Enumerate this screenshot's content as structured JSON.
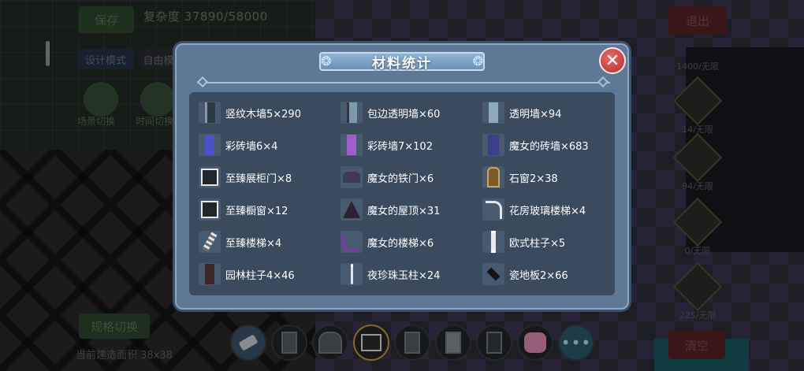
{
  "hud": {
    "save_label": "保存",
    "complexity_text": "复杂度 37890/58000",
    "exit_label": "退出",
    "design_mode_label": "设计模式",
    "free_mode_label": "自由模",
    "scene_switch_label": "场景切换",
    "time_switch_label": "时间切换",
    "spec_switch_label": "规格切换",
    "build_area_text": "当前建造面积 38x38",
    "clear_label": "清空"
  },
  "side_panel": {
    "counts": [
      "1400/无限",
      "14/无限",
      "94/无限",
      "0/无限",
      "225/无限"
    ]
  },
  "modal": {
    "title": "材料统计",
    "close_glyph": "✕",
    "items": [
      {
        "label": "竖纹木墙5×290",
        "icon": "wood-wall-icon",
        "color": "#2c3a46"
      },
      {
        "label": "包边透明墙×60",
        "icon": "edged-glass-wall-icon",
        "color": "#7e9aa8"
      },
      {
        "label": "透明墙×94",
        "icon": "glass-wall-icon",
        "color": "#8eaab8"
      },
      {
        "label": "彩砖墙6×4",
        "icon": "color-brick-wall-blue-icon",
        "color": "#4b52c8"
      },
      {
        "label": "彩砖墙7×102",
        "icon": "color-brick-wall-purple-icon",
        "color": "#a05ec8"
      },
      {
        "label": "魔女的砖墙×683",
        "icon": "witch-brick-wall-icon",
        "color": "#3b3f8a"
      },
      {
        "label": "至臻展柜门×8",
        "icon": "display-cabinet-door-icon",
        "color": "#e6e6ee"
      },
      {
        "label": "魔女的铁门×6",
        "icon": "witch-iron-gate-icon",
        "color": "#3e3a55"
      },
      {
        "label": "石窗2×38",
        "icon": "stone-window-icon",
        "color": "#c9a55a"
      },
      {
        "label": "至臻橱窗×12",
        "icon": "showcase-window-icon",
        "color": "#e6e6ee"
      },
      {
        "label": "魔女的屋顶×31",
        "icon": "witch-roof-icon",
        "color": "#2a2330"
      },
      {
        "label": "花房玻璃楼梯×4",
        "icon": "greenhouse-glass-stairs-icon",
        "color": "#e4e4ec"
      },
      {
        "label": "至臻楼梯×4",
        "icon": "premium-stairs-icon",
        "color": "#e4e4ec"
      },
      {
        "label": "魔女的楼梯×6",
        "icon": "witch-stairs-icon",
        "color": "#7a3aa8"
      },
      {
        "label": "欧式柱子×5",
        "icon": "european-pillar-icon",
        "color": "#e8e8f0"
      },
      {
        "label": "园林柱子4×46",
        "icon": "garden-pillar-icon",
        "color": "#3a2626"
      },
      {
        "label": "夜珍珠玉柱×24",
        "icon": "night-pearl-pillar-icon",
        "color": "#e0e0ea"
      },
      {
        "label": "瓷地板2×66",
        "icon": "ceramic-floor-icon",
        "color": "#141418"
      }
    ]
  },
  "toolbar": {
    "more_glyph": "•••",
    "tools": [
      "eraser-icon",
      "pillar-door-icon",
      "arch-gate-icon",
      "cabinet-door-icon",
      "dark-door-icon",
      "panel-door-icon",
      "frame-door-icon",
      "pink-bunny-icon"
    ]
  }
}
